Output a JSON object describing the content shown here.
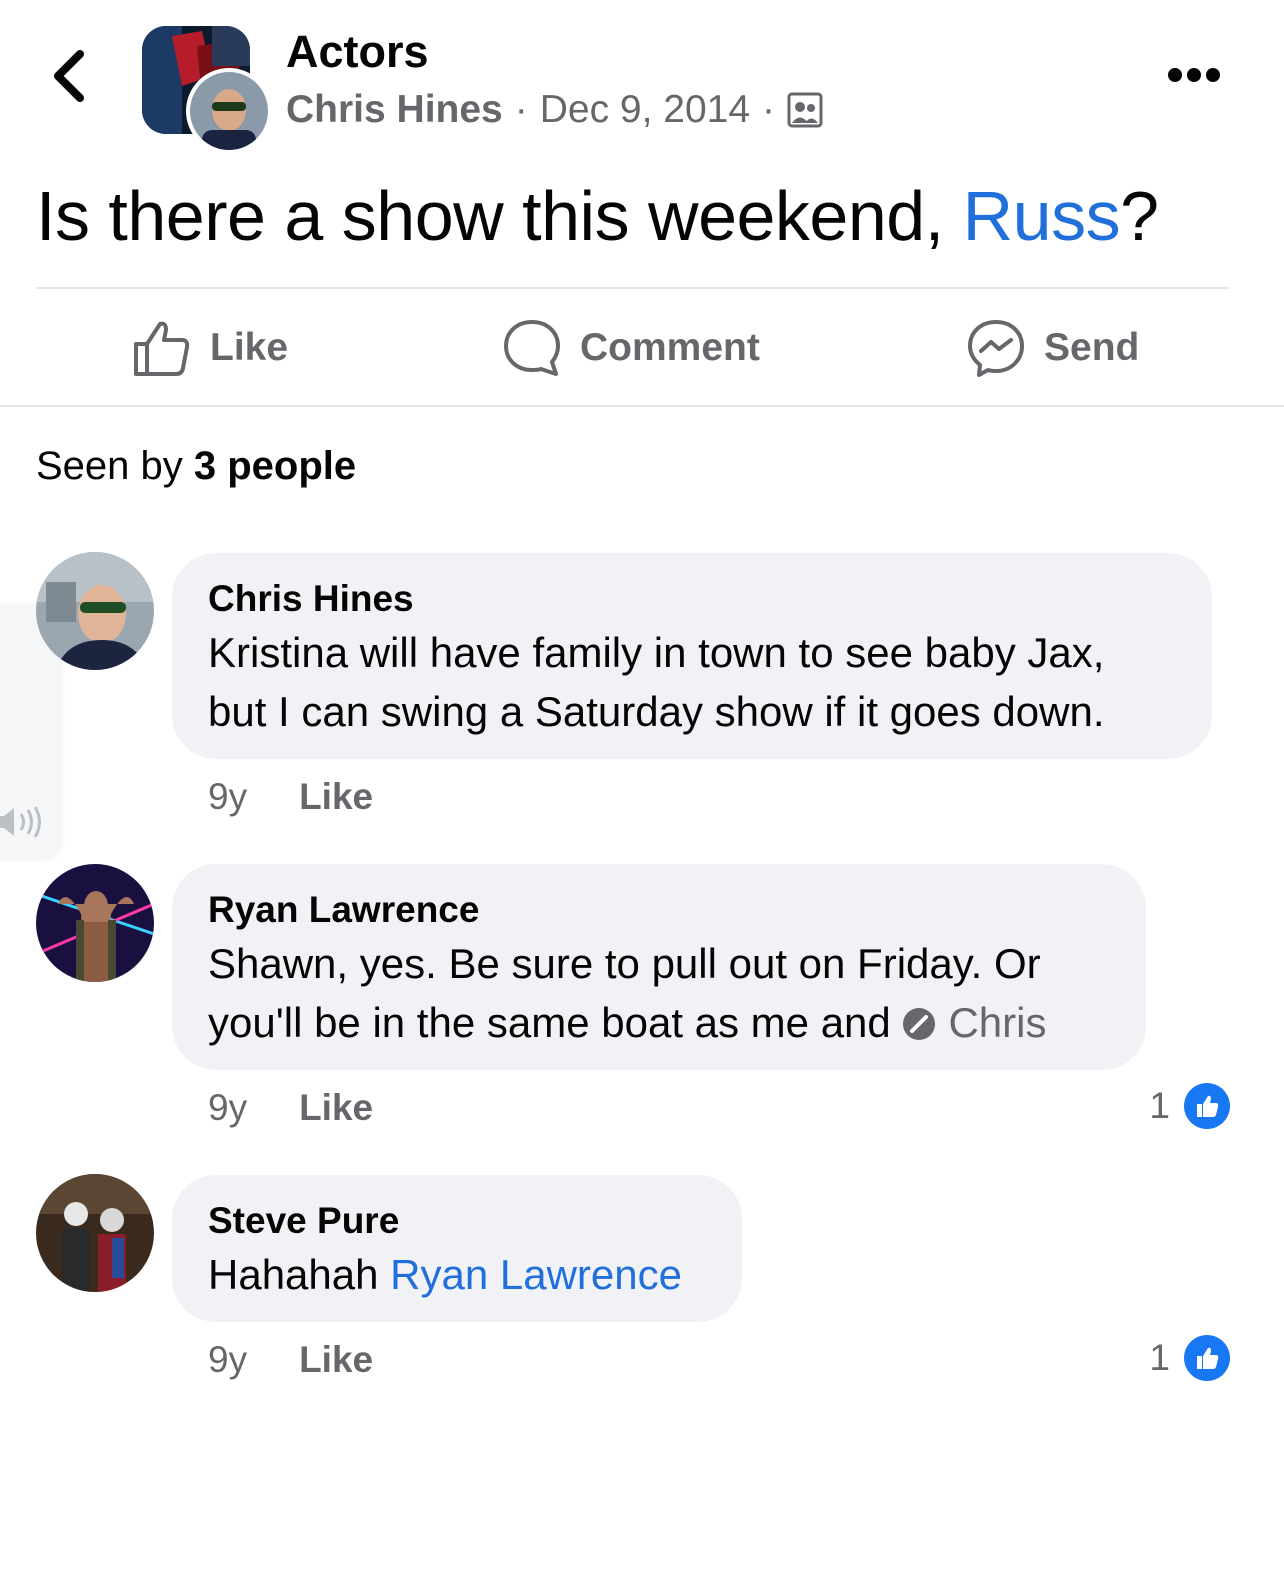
{
  "header": {
    "group_name": "Actors",
    "author": "Chris Hines",
    "separator": "·",
    "date": "Dec 9, 2014"
  },
  "post": {
    "text_before": "Is there a show this weekend, ",
    "mention": "Russ",
    "text_after": "?"
  },
  "actions": {
    "like": "Like",
    "comment": "Comment",
    "send": "Send"
  },
  "seen": {
    "prefix": "Seen by ",
    "count": "3 people"
  },
  "comments": [
    {
      "name": "Chris Hines",
      "line1": "Kristina will have family in town to see baby Jax,",
      "line2": "but I can swing a Saturday show if it goes down.",
      "age": "9y",
      "like": "Like"
    },
    {
      "name": "Ryan Lawrence",
      "line1": "Shawn, yes. Be sure to pull out on Friday. Or",
      "line2": "you'll be in the same boat as me and ",
      "mention": "Chris",
      "age": "9y",
      "like": "Like",
      "reactions": "1"
    },
    {
      "name": "Steve Pure",
      "text": "Hahahah ",
      "mention": "Ryan Lawrence",
      "age": "9y",
      "like": "Like",
      "reactions": "1"
    }
  ],
  "colors": {
    "link": "#216fdb",
    "secondary": "#65676b",
    "bubble": "#f0f2f5",
    "like_blue": "#1877f2"
  },
  "icons": [
    "back-chevron-icon",
    "more-options-icon",
    "members-privacy-icon",
    "thumbs-up-icon",
    "comment-bubble-icon",
    "messenger-icon",
    "speaker-icon",
    "like-reaction-icon"
  ]
}
